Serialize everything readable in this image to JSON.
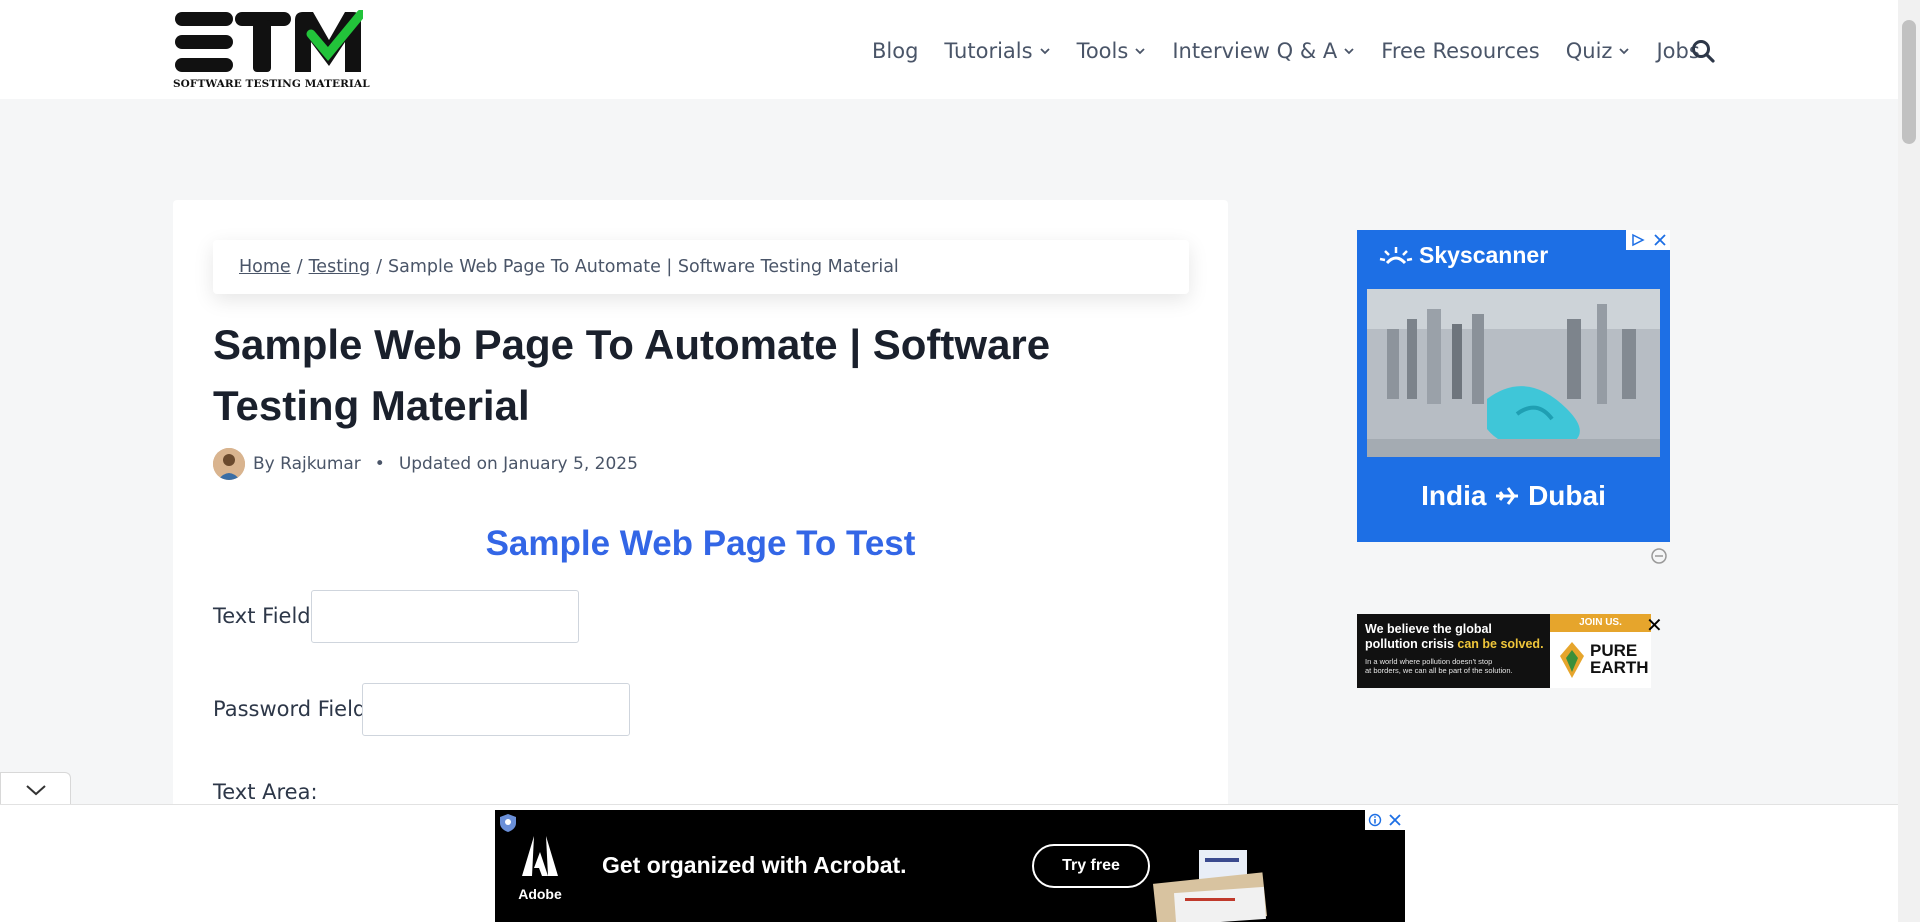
{
  "header": {
    "logo_letters": "STM",
    "logo_sub": "SOFTWARE TESTING MATERIAL",
    "nav": [
      {
        "label": "Blog",
        "dropdown": false
      },
      {
        "label": "Tutorials",
        "dropdown": true
      },
      {
        "label": "Tools",
        "dropdown": true
      },
      {
        "label": "Interview Q & A",
        "dropdown": true
      },
      {
        "label": "Free Resources",
        "dropdown": false
      },
      {
        "label": "Quiz",
        "dropdown": true
      },
      {
        "label": "Jobs",
        "dropdown": false
      }
    ]
  },
  "breadcrumb": {
    "home": "Home",
    "sep": "/",
    "category": "Testing",
    "current": "Sample Web Page To Automate | Software Testing Material"
  },
  "article": {
    "title": "Sample Web Page To Automate | Software Testing Material",
    "author_prefix": "By",
    "author": "Rajkumar",
    "updated": "Updated on January 5, 2025",
    "bullet": "•"
  },
  "form": {
    "heading": "Sample Web Page To Test",
    "text_field_label": "Text Field:",
    "password_field_label": "Password Field:",
    "text_area_label": "Text Area:"
  },
  "ads": {
    "skyscanner": {
      "brand": "Skyscanner",
      "route_from": "India",
      "route_to": "Dubai"
    },
    "pure_earth": {
      "line1": "We believe the global",
      "line2_plain": "pollution crisis",
      "line2_highlight": "can be solved.",
      "small1": "In a world where pollution doesn't stop",
      "small2": "at borders, we can all be part of the solution.",
      "join": "JOIN US.",
      "name_line1": "PURE",
      "name_line2": "EARTH",
      "close": "✕"
    },
    "acrobat": {
      "brand": "Adobe",
      "headline": "Get organized with Acrobat.",
      "cta": "Try free"
    }
  },
  "colors": {
    "accent_blue": "#3366e6",
    "logo_green": "#22c33a",
    "skyscanner_blue": "#1d6fe5",
    "pure_earth_gold": "#e6a52c"
  }
}
